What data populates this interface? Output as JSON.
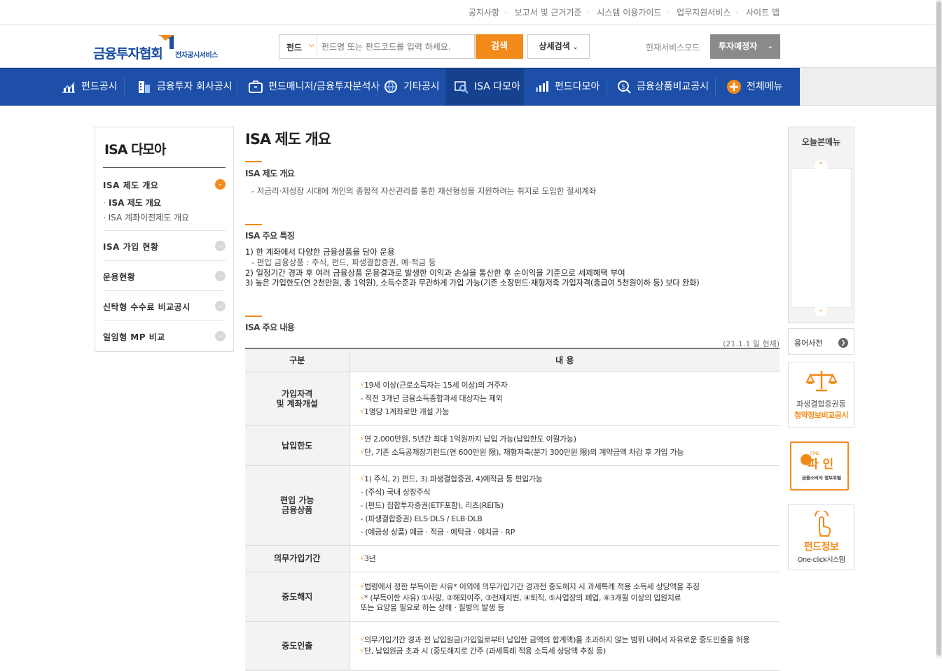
{
  "util_links": [
    "공지사항",
    "보고서 및 근거기준",
    "시스템 이용가이드",
    "업무지원서비스",
    "사이트 맵"
  ],
  "logo": {
    "main": "금융투자협회",
    "sub": "전자공시서비스"
  },
  "search": {
    "category": "펀드",
    "placeholder": "펀드명 또는 펀드코드를 입력 하세요.",
    "button": "검색",
    "detail": "상세검색"
  },
  "mode": {
    "label": "현재서비스모드",
    "value": "투자예정자"
  },
  "gnb": [
    "펀드공시",
    "금융투자 회사공시",
    "펀드매니저/금융투자분석사",
    "기타공시",
    "ISA 다모아",
    "펀드다모아",
    "금융상품비교공시",
    "전체메뉴"
  ],
  "lnb": {
    "title": "ISA 다모아",
    "menus": [
      "ISA 제도 개요",
      "ISA 가입 현황",
      "운용현황",
      "신탁형 수수료 비교공시",
      "일임형 MP 비교"
    ],
    "subs": [
      "ISA 제도 개요",
      "ISA 계좌이전제도 개요"
    ]
  },
  "content": {
    "title": "ISA 제도 개요",
    "s1": {
      "title": "ISA 제도 개요",
      "text": "- 저금리·저성장 시대에 개인의 종합적 자산관리를 통한 재산형성을 지원하려는 취지로 도입한 절세계좌"
    },
    "s2": {
      "title": "ISA 주요 특징",
      "lines": [
        "1) 한 계좌에서 다양한 금융상품을 담아 운용",
        "- 편입 금융상품 : 주식, 펀드, 파생결합증권, 예·적금 등",
        "2) 일정기간 경과 후 여러 금융상품 운용결과로 발생한 이익과 손실을 통산한 후 순이익을 기준으로 세제혜택 부여",
        "3) 높은 가입한도(연 2천만원, 총 1억원), 소득수준과 무관하게 가입 가능(기존 소장펀드·재형저축 가입자격(총급여 5천원이하 등) 보다 완화)"
      ]
    },
    "s3": {
      "title": "ISA 주요 내용",
      "date": "(21.1.1 일 현재)"
    },
    "table": {
      "headers": [
        "구분",
        "내 용"
      ],
      "rows": [
        {
          "k": [
            "가입자격",
            "및 계좌개설"
          ],
          "v": [
            "19세 이상(근로소득자는 15세 이상)의 거주자",
            "- 직전 3개년 금융소득종합과세 대상자는 제외",
            "1명당 1계좌로만 개설 가능"
          ]
        },
        {
          "k": [
            "납입한도"
          ],
          "v": [
            "연 2,000만원, 5년간 최대 1억원까지 납입 가능(납입한도 이월가능)",
            "단, 기존 소득공제장기펀드(연 600만원 限), 재형저축(분기 300만원 限)의 계약금액 차감 후 가입 가능"
          ]
        },
        {
          "k": [
            "편입 가능",
            "금융상품"
          ],
          "v": [
            "1) 주식, 2) 펀드, 3) 파생결합증권, 4)예적금 등 편입가능",
            "- (주식) 국내 상장주식",
            "- (펀드) 집합투자증권(ETF포함), 리츠(REITs)",
            "- (파생결합증권) ELS·DLS / ELB·DLB",
            "- (예금성 상품) 예금 · 적금 · 예탁금 · 예치금 · RP"
          ]
        },
        {
          "k": [
            "의무가입기간"
          ],
          "v": [
            "3년"
          ]
        },
        {
          "k": [
            "중도해지"
          ],
          "v": [
            "법령에서 정한 부득이한 사유* 이외에 의무가입기간 경과전 중도해지 시 과세특례 적용 소득세 상당액을 추징",
            "* (부득이한 사유) ①사망, ②해외이주, ③천재지변, ④퇴직, ⑤사업장의 폐업, ⑥3개월 이상의 입원치료",
            "또는 요양을 필요로 하는 상해 · 질병의 발생 등"
          ]
        },
        {
          "k": [
            "중도인출"
          ],
          "v": [
            "의무가입기간 경과 전 납입원금(가입일로부터 납입한 금액의 합계액)을 초과하지 않는 범위 내에서 자유로운 중도인출을 허용",
            "단, 납입원금 초과 시 (중도해지로 간주 (과세특례 적용 소득세 상당액 추징 등)"
          ]
        }
      ]
    }
  },
  "quick": {
    "title": "오늘본메뉴",
    "dict": "용어사전",
    "b1": [
      "파생결합증권등",
      "청약정보비교공시"
    ],
    "b2": [
      "파 인",
      "금융소비자 정보포털",
      "FINE"
    ],
    "b3": [
      "펀드정보",
      "One-click시스템"
    ]
  },
  "colors": {
    "brand_blue": "#1d4fa8",
    "accent_orange": "#f28a1a"
  }
}
